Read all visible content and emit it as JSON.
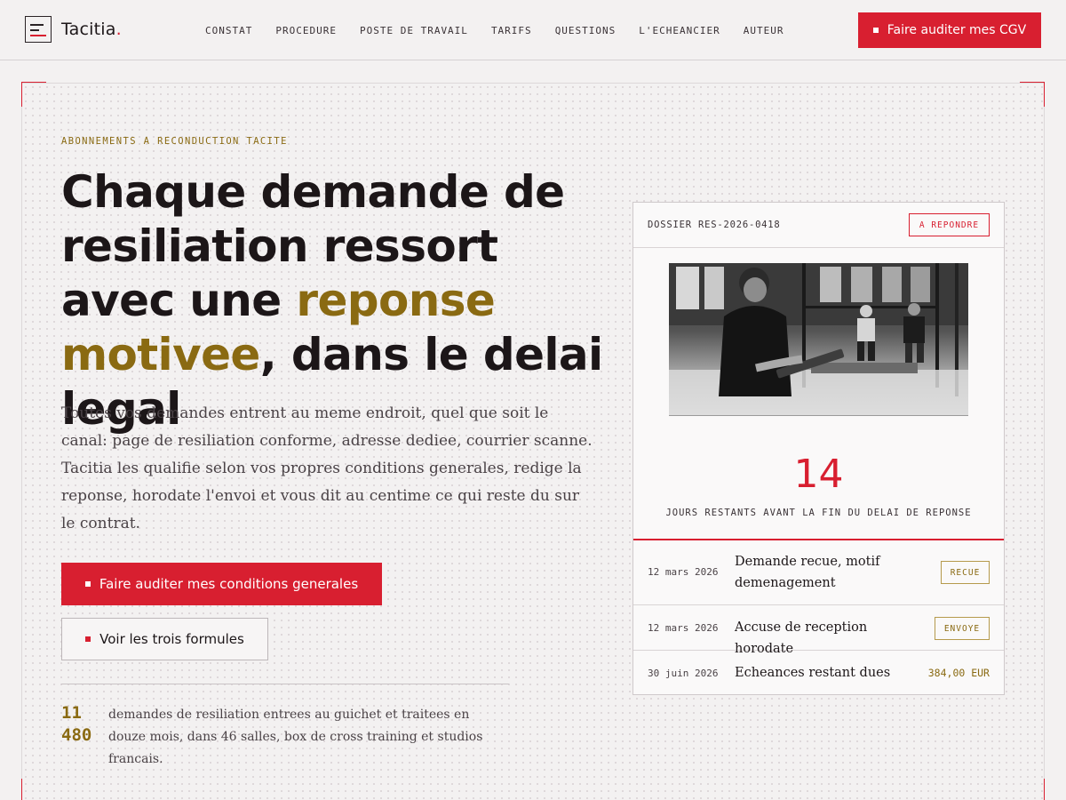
{
  "brand": {
    "name": "Tacitia",
    "dot": ".",
    "accent_color": "#d81f30",
    "gold_color": "#8a6a12"
  },
  "nav": {
    "items": [
      {
        "label": "CONSTAT"
      },
      {
        "label": "PROCEDURE"
      },
      {
        "label": "POSTE DE TRAVAIL"
      },
      {
        "label": "TARIFS"
      },
      {
        "label": "QUESTIONS"
      },
      {
        "label": "L'ECHEANCIER"
      },
      {
        "label": "AUTEUR"
      }
    ],
    "cta_label": "Faire auditer mes CGV"
  },
  "hero": {
    "eyebrow": "ABONNEMENTS A RECONDUCTION TACITE",
    "headline_part1": "Chaque demande de resiliation ressort avec une ",
    "headline_accent": "reponse motivee",
    "headline_part2": ", dans le delai legal",
    "lede": "Toutes vos demandes entrent au meme endroit, quel que soit le canal: page de resiliation conforme, adresse dediee, courrier scanne. Tacitia les qualifie selon vos propres conditions generales, redige la reponse, horodate l'envoi et vous dit au centime ce qui reste du sur le contrat.",
    "primary_cta": "Faire auditer mes conditions generales",
    "secondary_cta": "Voir les trois formules",
    "stat_number": "11 480",
    "stat_text": "demandes de resiliation entrees au guichet et traitees en douze mois, dans 46 salles, box de cross training et studios francais."
  },
  "dossier": {
    "id": "DOSSIER RES-2026-0418",
    "status_badge": "A REPONDRE",
    "photo_icon": "gym-coach-tablet-photo",
    "days_remaining": "14",
    "days_label": "JOURS RESTANTS AVANT LA FIN DU DELAI DE REPONSE",
    "rows": [
      {
        "date": "12 mars 2026",
        "title": "Demande recue, motif demenagement",
        "tag": "RECUE"
      },
      {
        "date": "12 mars 2026",
        "title": "Accuse de reception horodate",
        "tag": "ENVOYE"
      },
      {
        "date": "30 juin 2026",
        "title": "Echeances restant dues",
        "amount": "384,00 EUR"
      }
    ]
  }
}
